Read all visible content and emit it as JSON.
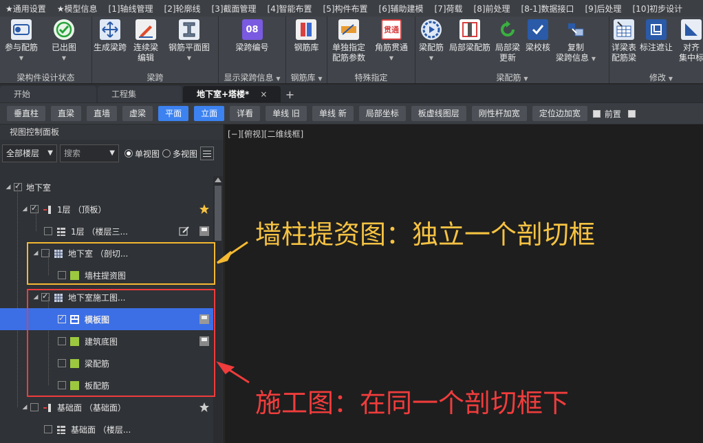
{
  "menu": [
    "★通用设置",
    "★模型信息",
    "[1]轴线管理",
    "[2]轮廓线",
    "[3]截面管理",
    "[4]智能布置",
    "[5]构件布置",
    "[6]辅助建模",
    "[7]荷载",
    "[8]前处理",
    "[8-1]数据接口",
    "[9]后处理",
    "[10]初步设计"
  ],
  "ribbon": {
    "g1": {
      "label": "梁构件设计状态",
      "b1": "参与配筋",
      "b2": "已出图"
    },
    "g2": {
      "label": "梁跨",
      "b1": "生成梁跨",
      "b2": "连续梁",
      "b2b": "编辑",
      "b3": "钢筋平面图"
    },
    "g3": {
      "label": "显示梁跨信息",
      "b1": "梁跨编号",
      "badge": "08"
    },
    "g4": {
      "label": "钢筋库",
      "b1": "钢筋库"
    },
    "g5": {
      "label": "特殊指定",
      "b1": "单独指定",
      "b1b": "配筋参数",
      "b2": "角筋贯通",
      "badge": "贯通"
    },
    "g6": {
      "label": "梁配筋",
      "b1": "梁配筋",
      "b2": "局部梁配筋",
      "b3": "局部梁",
      "b3b": "更新",
      "b4": "梁校核",
      "b5": "复制",
      "b5b": "梁跨信息"
    },
    "g7": {
      "label": "修改",
      "b1": "详梁表",
      "b1b": "配筋梁",
      "b2": "标注遮让",
      "b3": "对齐",
      "b3b": "集中标"
    }
  },
  "tabs": {
    "t1": "开始",
    "t2": "工程集",
    "t3": "地下室+塔楼*",
    "close": "×",
    "plus": "+"
  },
  "toolbar": {
    "b1": "垂直柱",
    "b2": "直梁",
    "b3": "直墙",
    "b4": "虚梁",
    "b5": "平面",
    "b6": "立面",
    "b7": "详看",
    "b8": "单线 旧",
    "b9": "单线 新",
    "b10": "局部坐标",
    "b11": "板虚线图层",
    "b12": "刚性杆加宽",
    "b13": "定位边加宽",
    "c1": "前置"
  },
  "panel": {
    "title": "视图控制面板",
    "floor_select": "全部楼层",
    "search_placeholder": "搜索",
    "radio_single": "单视图",
    "radio_multi": "多视图"
  },
  "tree": {
    "r1": "地下室",
    "r2": "1层 （顶板）",
    "r3": "1层 （楼层三...",
    "r4": "地下室 （剖切...",
    "r5": "墙柱提资图",
    "r6": "地下室施工图...",
    "r7": "模板图",
    "r8": "建筑底图",
    "r9": "梁配筋",
    "r10": "板配筋",
    "r11": "基础面 （基础面）",
    "r12": "基础面 （楼层..."
  },
  "view": {
    "label": "[−][俯视][二维线框]"
  },
  "annotations": {
    "a1": "墙柱提资图：独立一个剖切框",
    "a2": "施工图：在同一个剖切框下",
    "c1": "#f5b932",
    "c2": "#f03c3c"
  }
}
